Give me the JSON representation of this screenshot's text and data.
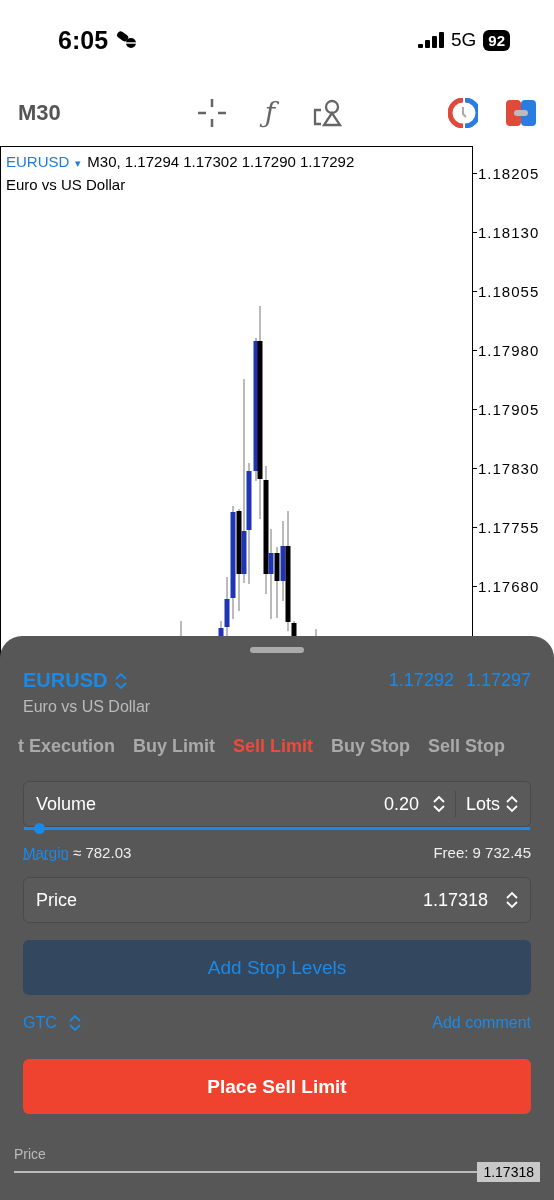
{
  "status_bar": {
    "time": "6:05",
    "network": "5G",
    "battery": "92"
  },
  "toolbar": {
    "timeframe": "M30",
    "function_glyph": "ƒ"
  },
  "chart": {
    "symbol": "EURUSD",
    "symbol_caret": "▾",
    "quote": "M30, 1.17294 1.17302 1.17290 1.17292",
    "description": "Euro vs US Dollar",
    "price_axis": [
      "1.18205",
      "1.18130",
      "1.18055",
      "1.17980",
      "1.17905",
      "1.17830",
      "1.17755",
      "1.17680"
    ]
  },
  "order_sheet": {
    "symbol": "EURUSD",
    "bid": "1.17292",
    "ask": "1.17297",
    "description": "Euro vs US Dollar",
    "tabs": [
      {
        "label": "t Execution",
        "selected": false
      },
      {
        "label": "Buy Limit",
        "selected": false
      },
      {
        "label": "Sell Limit",
        "selected": true
      },
      {
        "label": "Buy Stop",
        "selected": false
      },
      {
        "label": "Sell Stop",
        "selected": false
      }
    ],
    "volume": {
      "label": "Volume",
      "value": "0.20",
      "unit": "Lots",
      "level": 0.03
    },
    "margin": {
      "label": "Margin",
      "value": "≈ 782.03",
      "free": "Free: 9 732.45"
    },
    "price": {
      "label": "Price",
      "value": "1.17318"
    },
    "stop_levels_button": "Add Stop Levels",
    "expiration": "GTC",
    "comment_link": "Add comment",
    "place_button": "Place Sell Limit",
    "price_line": {
      "label": "Price",
      "value": "1.17318"
    }
  }
}
